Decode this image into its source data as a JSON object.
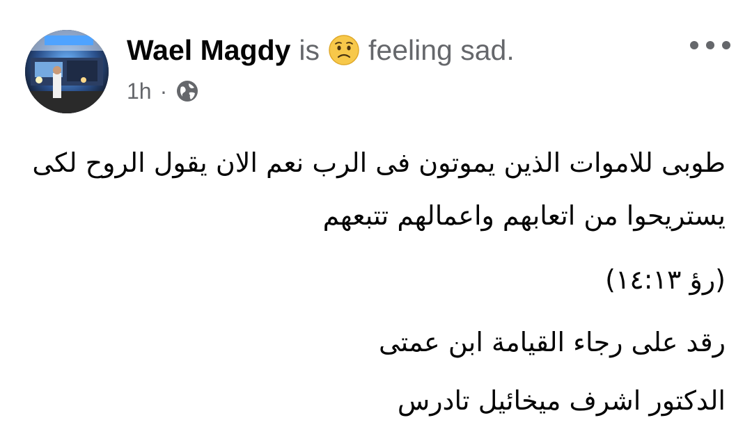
{
  "post": {
    "author": {
      "name": "Wael Magdy",
      "avatar_icon": "profile-photo"
    },
    "status": {
      "is_text": "is",
      "feeling_emoji": "sad-face-emoji",
      "feeling_text": "feeling sad."
    },
    "meta": {
      "time": "1h",
      "separator": "·",
      "privacy_icon": "globe-icon"
    },
    "more_icon": "more-horizontal-icon",
    "body": {
      "paragraphs": [
        "طوبى للاموات الذين يموتون فى الرب نعم الان يقول الروح لكى يستريحوا من اتعابهم واعمالهم تتبعهم",
        "(رؤ ١٤:١٣)",
        "رقد على رجاء القيامة ابن عمتى",
        "الدكتور اشرف ميخائيل تادرس"
      ]
    }
  },
  "colors": {
    "name": "#050505",
    "secondary_text": "#65676b",
    "body_text": "#050505",
    "emoji_face": "#f7c84a",
    "background": "#ffffff"
  }
}
